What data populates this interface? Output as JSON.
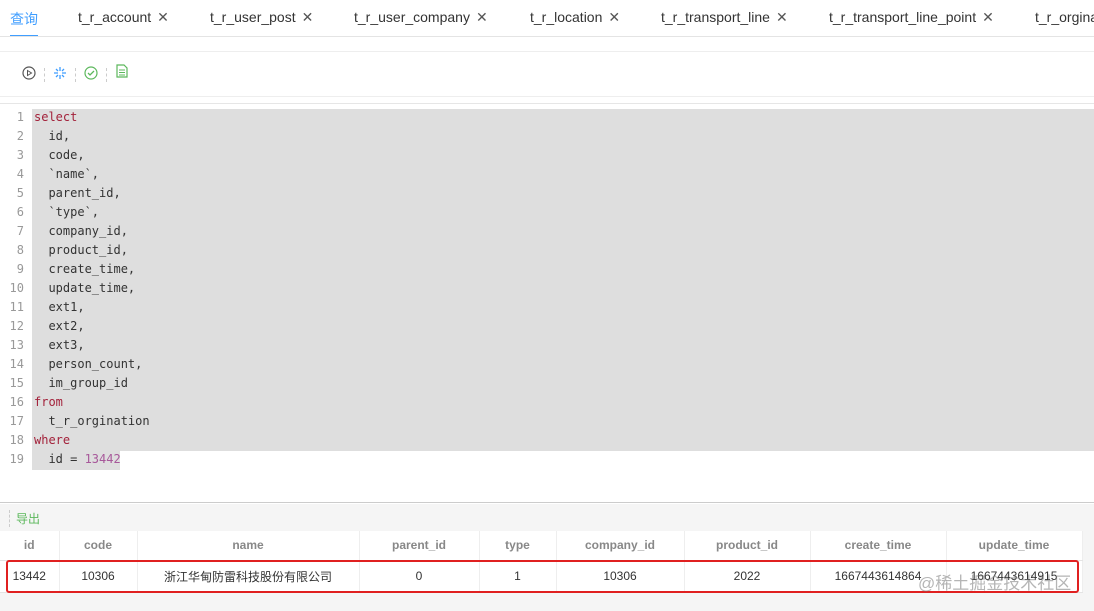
{
  "tabs": [
    {
      "label": "查询",
      "closable": false,
      "active": true
    },
    {
      "label": "t_r_account",
      "closable": true
    },
    {
      "label": "t_r_user_post",
      "closable": true
    },
    {
      "label": "t_r_user_company",
      "closable": true
    },
    {
      "label": "t_r_location",
      "closable": true
    },
    {
      "label": "t_r_transport_line",
      "closable": true
    },
    {
      "label": "t_r_transport_line_point",
      "closable": true
    },
    {
      "label": "t_r_orgina",
      "closable": false
    }
  ],
  "close_glyph": "✕",
  "toolbar": {
    "icons": [
      "run-icon",
      "format-icon",
      "check-icon",
      "document-icon"
    ],
    "colors": {
      "run": "#555555",
      "format": "#409eff",
      "check": "#5cb85c",
      "doc": "#5cb85c"
    }
  },
  "editor": {
    "lines": [
      {
        "n": "1",
        "kw": "select",
        "text": ""
      },
      {
        "n": "2",
        "text": "  id,"
      },
      {
        "n": "3",
        "text": "  code,"
      },
      {
        "n": "4",
        "text": "  `name`,"
      },
      {
        "n": "5",
        "text": "  parent_id,"
      },
      {
        "n": "6",
        "text": "  `type`,"
      },
      {
        "n": "7",
        "text": "  company_id,"
      },
      {
        "n": "8",
        "text": "  product_id,"
      },
      {
        "n": "9",
        "text": "  create_time,"
      },
      {
        "n": "10",
        "text": "  update_time,"
      },
      {
        "n": "11",
        "text": "  ext1,"
      },
      {
        "n": "12",
        "text": "  ext2,"
      },
      {
        "n": "13",
        "text": "  ext3,"
      },
      {
        "n": "14",
        "text": "  person_count,"
      },
      {
        "n": "15",
        "text": "  im_group_id"
      },
      {
        "n": "16",
        "kw": "from",
        "text": ""
      },
      {
        "n": "17",
        "text": "  t_r_orgination"
      },
      {
        "n": "18",
        "kw": "where",
        "text": ""
      },
      {
        "n": "19",
        "text": "  id = ",
        "num": "13442"
      }
    ]
  },
  "results": {
    "export_label": "导出",
    "columns": [
      "id",
      "code",
      "name",
      "parent_id",
      "type",
      "company_id",
      "product_id",
      "create_time",
      "update_time"
    ],
    "rows": [
      [
        "13442",
        "10306",
        "浙江华甸防雷科技股份有限公司",
        "0",
        "1",
        "10306",
        "2022",
        "1667443614864",
        "1667443614915"
      ]
    ]
  },
  "watermark": "@稀土掘金技术社区"
}
